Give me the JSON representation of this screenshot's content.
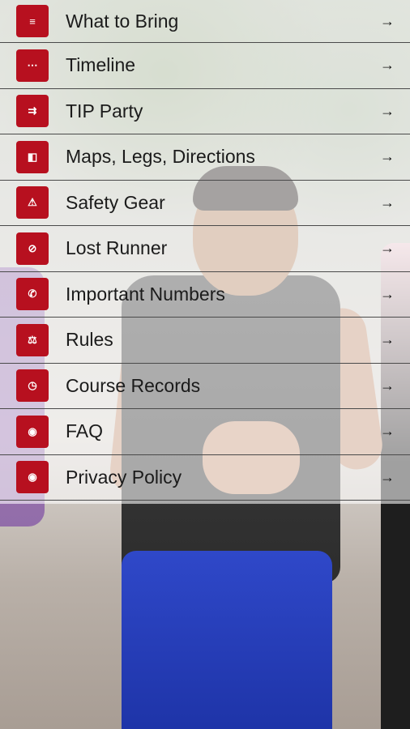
{
  "menu": {
    "items": [
      {
        "label": "What to Bring",
        "icon": "list-icon",
        "glyph": "≡"
      },
      {
        "label": "Timeline",
        "icon": "dots-icon",
        "glyph": "⋯"
      },
      {
        "label": "TIP Party",
        "icon": "party-icon",
        "glyph": "⇉"
      },
      {
        "label": "Maps, Legs, Directions",
        "icon": "map-icon",
        "glyph": "◧"
      },
      {
        "label": "Safety Gear",
        "icon": "warning-icon",
        "glyph": "⚠"
      },
      {
        "label": "Lost Runner",
        "icon": "location-off-icon",
        "glyph": "⊘"
      },
      {
        "label": "Important Numbers",
        "icon": "phone-icon",
        "glyph": "✆"
      },
      {
        "label": "Rules",
        "icon": "gavel-icon",
        "glyph": "⚖"
      },
      {
        "label": "Course Records",
        "icon": "history-icon",
        "glyph": "◷"
      },
      {
        "label": "FAQ",
        "icon": "globe-icon",
        "glyph": "◉"
      },
      {
        "label": "Privacy Policy",
        "icon": "globe-icon",
        "glyph": "◉"
      }
    ],
    "arrow_glyph": "→"
  },
  "colors": {
    "accent": "#b7101f",
    "overlay": "rgba(255,255,255,0.58)",
    "divider": "#4a4a4a"
  }
}
